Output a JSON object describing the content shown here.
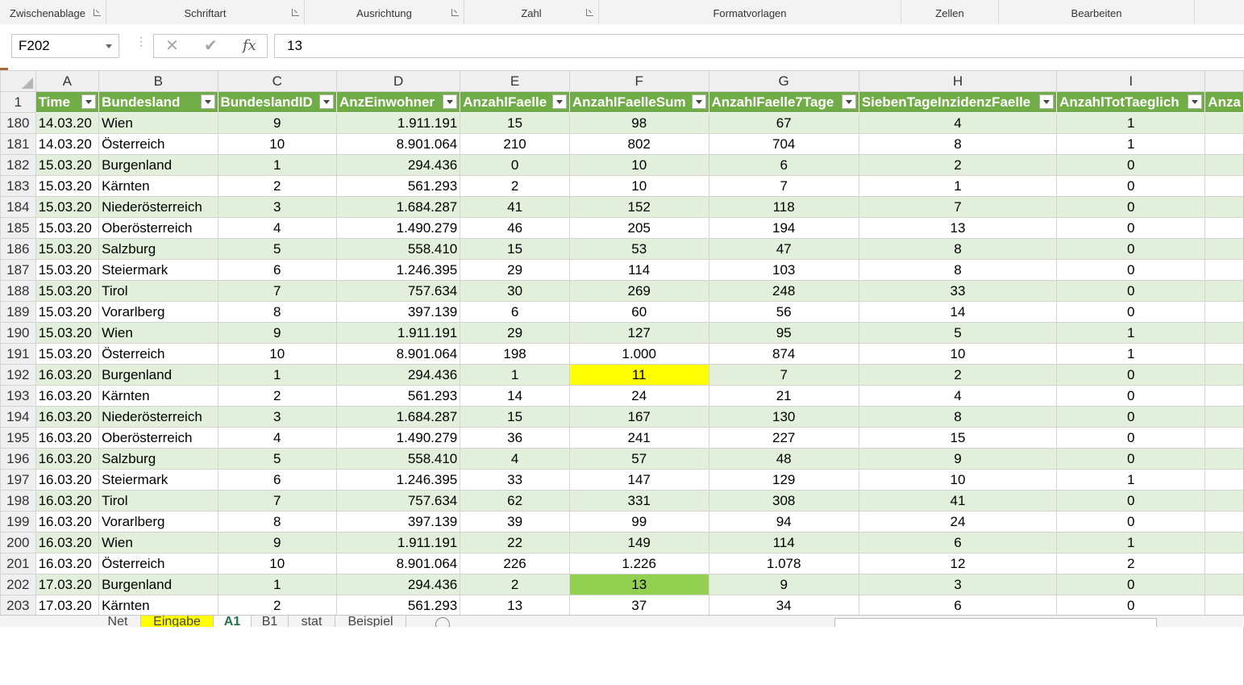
{
  "ribbon": {
    "groups": [
      "Zwischenablage",
      "Schriftart",
      "Ausrichtung",
      "Zahl",
      "Formatvorlagen",
      "Zellen",
      "Bearbeiten"
    ]
  },
  "formula_bar": {
    "name_box": "F202",
    "value": "13",
    "fx_label": "fx",
    "cancel_glyph": "✕",
    "enter_glyph": "✔"
  },
  "grid": {
    "column_letters": [
      "A",
      "B",
      "C",
      "D",
      "E",
      "F",
      "G",
      "H",
      "I",
      ""
    ],
    "header_row_number": "1",
    "headers": [
      "Time",
      "Bundesland",
      "BundeslandID",
      "AnzEinwohner",
      "AnzahlFaelle",
      "AnzahlFaelleSum",
      "AnzahlFaelle7Tage",
      "SiebenTageInzidenzFaelle",
      "AnzahlTotTaeglich",
      "Anza"
    ],
    "rows": [
      {
        "n": "180",
        "c": [
          "14.03.20",
          "Wien",
          "9",
          "1.911.191",
          "15",
          "98",
          "67",
          "4",
          "1"
        ]
      },
      {
        "n": "181",
        "c": [
          "14.03.20",
          "Österreich",
          "10",
          "8.901.064",
          "210",
          "802",
          "704",
          "8",
          "1"
        ]
      },
      {
        "n": "182",
        "c": [
          "15.03.20",
          "Burgenland",
          "1",
          "294.436",
          "0",
          "10",
          "6",
          "2",
          "0"
        ]
      },
      {
        "n": "183",
        "c": [
          "15.03.20",
          "Kärnten",
          "2",
          "561.293",
          "2",
          "10",
          "7",
          "1",
          "0"
        ]
      },
      {
        "n": "184",
        "c": [
          "15.03.20",
          "Niederösterreich",
          "3",
          "1.684.287",
          "41",
          "152",
          "118",
          "7",
          "0"
        ]
      },
      {
        "n": "185",
        "c": [
          "15.03.20",
          "Oberösterreich",
          "4",
          "1.490.279",
          "46",
          "205",
          "194",
          "13",
          "0"
        ]
      },
      {
        "n": "186",
        "c": [
          "15.03.20",
          "Salzburg",
          "5",
          "558.410",
          "15",
          "53",
          "47",
          "8",
          "0"
        ]
      },
      {
        "n": "187",
        "c": [
          "15.03.20",
          "Steiermark",
          "6",
          "1.246.395",
          "29",
          "114",
          "103",
          "8",
          "0"
        ]
      },
      {
        "n": "188",
        "c": [
          "15.03.20",
          "Tirol",
          "7",
          "757.634",
          "30",
          "269",
          "248",
          "33",
          "0"
        ]
      },
      {
        "n": "189",
        "c": [
          "15.03.20",
          "Vorarlberg",
          "8",
          "397.139",
          "6",
          "60",
          "56",
          "14",
          "0"
        ]
      },
      {
        "n": "190",
        "c": [
          "15.03.20",
          "Wien",
          "9",
          "1.911.191",
          "29",
          "127",
          "95",
          "5",
          "1"
        ]
      },
      {
        "n": "191",
        "c": [
          "15.03.20",
          "Österreich",
          "10",
          "8.901.064",
          "198",
          "1.000",
          "874",
          "10",
          "1"
        ]
      },
      {
        "n": "192",
        "c": [
          "16.03.20",
          "Burgenland",
          "1",
          "294.436",
          "1",
          "11",
          "7",
          "2",
          "0"
        ]
      },
      {
        "n": "193",
        "c": [
          "16.03.20",
          "Kärnten",
          "2",
          "561.293",
          "14",
          "24",
          "21",
          "4",
          "0"
        ]
      },
      {
        "n": "194",
        "c": [
          "16.03.20",
          "Niederösterreich",
          "3",
          "1.684.287",
          "15",
          "167",
          "130",
          "8",
          "0"
        ]
      },
      {
        "n": "195",
        "c": [
          "16.03.20",
          "Oberösterreich",
          "4",
          "1.490.279",
          "36",
          "241",
          "227",
          "15",
          "0"
        ]
      },
      {
        "n": "196",
        "c": [
          "16.03.20",
          "Salzburg",
          "5",
          "558.410",
          "4",
          "57",
          "48",
          "9",
          "0"
        ]
      },
      {
        "n": "197",
        "c": [
          "16.03.20",
          "Steiermark",
          "6",
          "1.246.395",
          "33",
          "147",
          "129",
          "10",
          "1"
        ]
      },
      {
        "n": "198",
        "c": [
          "16.03.20",
          "Tirol",
          "7",
          "757.634",
          "62",
          "331",
          "308",
          "41",
          "0"
        ]
      },
      {
        "n": "199",
        "c": [
          "16.03.20",
          "Vorarlberg",
          "8",
          "397.139",
          "39",
          "99",
          "94",
          "24",
          "0"
        ]
      },
      {
        "n": "200",
        "c": [
          "16.03.20",
          "Wien",
          "9",
          "1.911.191",
          "22",
          "149",
          "114",
          "6",
          "1"
        ]
      },
      {
        "n": "201",
        "c": [
          "16.03.20",
          "Österreich",
          "10",
          "8.901.064",
          "226",
          "1.226",
          "1.078",
          "12",
          "2"
        ]
      },
      {
        "n": "202",
        "c": [
          "17.03.20",
          "Burgenland",
          "1",
          "294.436",
          "2",
          "13",
          "9",
          "3",
          "0"
        ]
      },
      {
        "n": "203",
        "c": [
          "17.03.20",
          "Kärnten",
          "2",
          "561.293",
          "13",
          "37",
          "34",
          "6",
          "0"
        ]
      }
    ],
    "highlights": {
      "yellow_cell": {
        "row": "192",
        "col": "F",
        "color": "#ffff00"
      },
      "green_cell": {
        "row": "202",
        "col": "F",
        "color": "#92d050"
      }
    },
    "colors": {
      "header_bg": "#70ad47",
      "band_bg": "#e2efda"
    }
  },
  "sheet_tabs": [
    {
      "label": "Net",
      "style": "normal"
    },
    {
      "label": "Eingabe",
      "style": "yellow"
    },
    {
      "label": "A1",
      "style": "active"
    },
    {
      "label": "B1",
      "style": "normal"
    },
    {
      "label": "stat",
      "style": "normal"
    },
    {
      "label": "Beispiel",
      "style": "normal"
    }
  ]
}
